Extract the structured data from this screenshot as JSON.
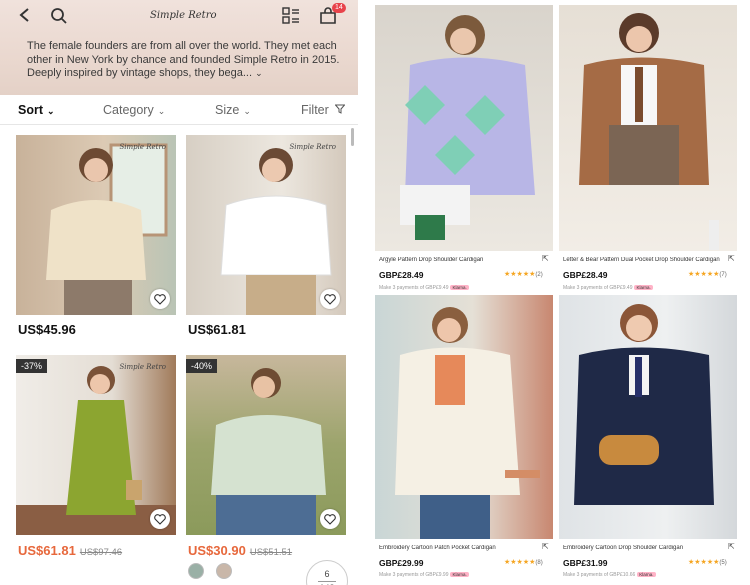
{
  "left": {
    "header": {
      "logo": "Simple Retro",
      "cart_count": "14",
      "description": "The female founders are from all over the world. They met each other in New York by chance and founded Simple Retro in 2015. Deeply inspired by vintage shops, they bega..."
    },
    "filters": {
      "sort": "Sort",
      "category": "Category",
      "size": "Size",
      "filter": "Filter"
    },
    "products": [
      {
        "watermark": "Simple Retro",
        "price": "US$45.96",
        "discount": "",
        "old_price": ""
      },
      {
        "watermark": "Simple Retro",
        "price": "US$61.81",
        "discount": "",
        "old_price": ""
      },
      {
        "watermark": "Simple Retro",
        "price": "US$61.81",
        "discount": "-37%",
        "old_price": "US$97.46"
      },
      {
        "watermark": "",
        "price": "US$30.90",
        "discount": "-40%",
        "old_price": "US$51.51"
      }
    ],
    "pager": {
      "current": "6",
      "total": "148"
    }
  },
  "right": {
    "products": [
      {
        "name": "Argyle Pattern Drop Shoulder Cardigan",
        "price": "GBP£28.49",
        "pay": "Make 3 payments of GBP£9.49",
        "klarna": "Klarna.",
        "rating_count": "(2)"
      },
      {
        "name": "Letter & Bear Pattern Dual Pocket Drop Shoulder Cardigan",
        "price": "GBP£28.49",
        "pay": "Make 3 payments of GBP£9.49",
        "klarna": "Klarna.",
        "rating_count": "(7)"
      },
      {
        "name": "Embroidery Cartoon Patch Pocket Cardigan",
        "price": "GBP£29.99",
        "pay": "Make 3 payments of GBP£9.99",
        "klarna": "Klarna.",
        "rating_count": "(8)"
      },
      {
        "name": "Embroidery Cartoon Drop Shoulder Cardigan",
        "price": "GBP£31.99",
        "pay": "Make 3 payments of GBP£10.66",
        "klarna": "Klarna.",
        "rating_count": "(5)"
      }
    ]
  },
  "colors": {
    "sale": "#e7683c",
    "star": "#f5a623",
    "badge": "#e8434b",
    "klarna": "#ffb3c7"
  }
}
